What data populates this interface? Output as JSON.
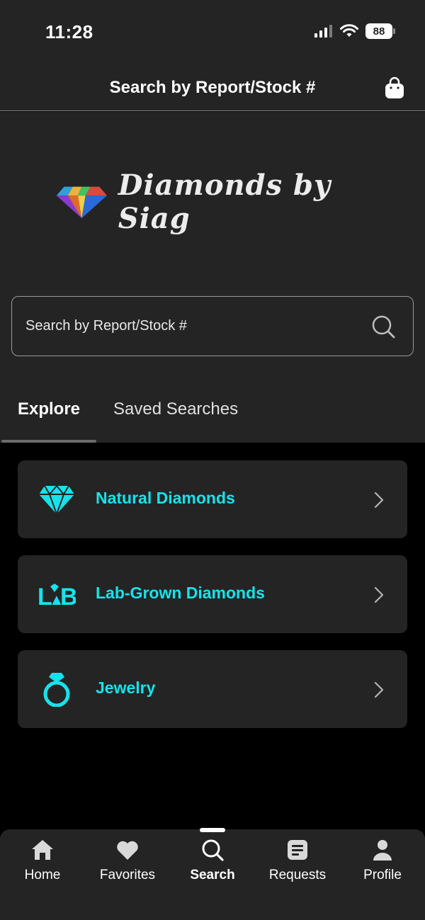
{
  "status_bar": {
    "time": "11:28",
    "battery": "88",
    "icons": [
      "signal-icon",
      "wifi-icon",
      "battery-icon"
    ]
  },
  "header": {
    "title": "Search by Report/Stock #",
    "cart_icon": "shopping-bag-icon"
  },
  "logo": {
    "text": "Diamonds by Siag",
    "icon": "diamond-logo-icon"
  },
  "search": {
    "placeholder": "Search by Report/Stock #",
    "icon": "search-icon"
  },
  "tabs": [
    {
      "label": "Explore",
      "active": true
    },
    {
      "label": "Saved Searches",
      "active": false
    }
  ],
  "categories": [
    {
      "label": "Natural Diamonds",
      "icon": "diamond-icon"
    },
    {
      "label": "Lab-Grown Diamonds",
      "icon": "lab-icon"
    },
    {
      "label": "Jewelry",
      "icon": "ring-icon"
    }
  ],
  "bottom_nav": [
    {
      "label": "Home",
      "icon": "home-icon",
      "active": false
    },
    {
      "label": "Favorites",
      "icon": "heart-icon",
      "active": false
    },
    {
      "label": "Search",
      "icon": "search-icon",
      "active": true
    },
    {
      "label": "Requests",
      "icon": "requests-icon",
      "active": false
    },
    {
      "label": "Profile",
      "icon": "profile-icon",
      "active": false
    }
  ],
  "colors": {
    "background": "#000000",
    "surface": "#242424",
    "accent": "#17e2ec",
    "text": "#ffffff"
  }
}
